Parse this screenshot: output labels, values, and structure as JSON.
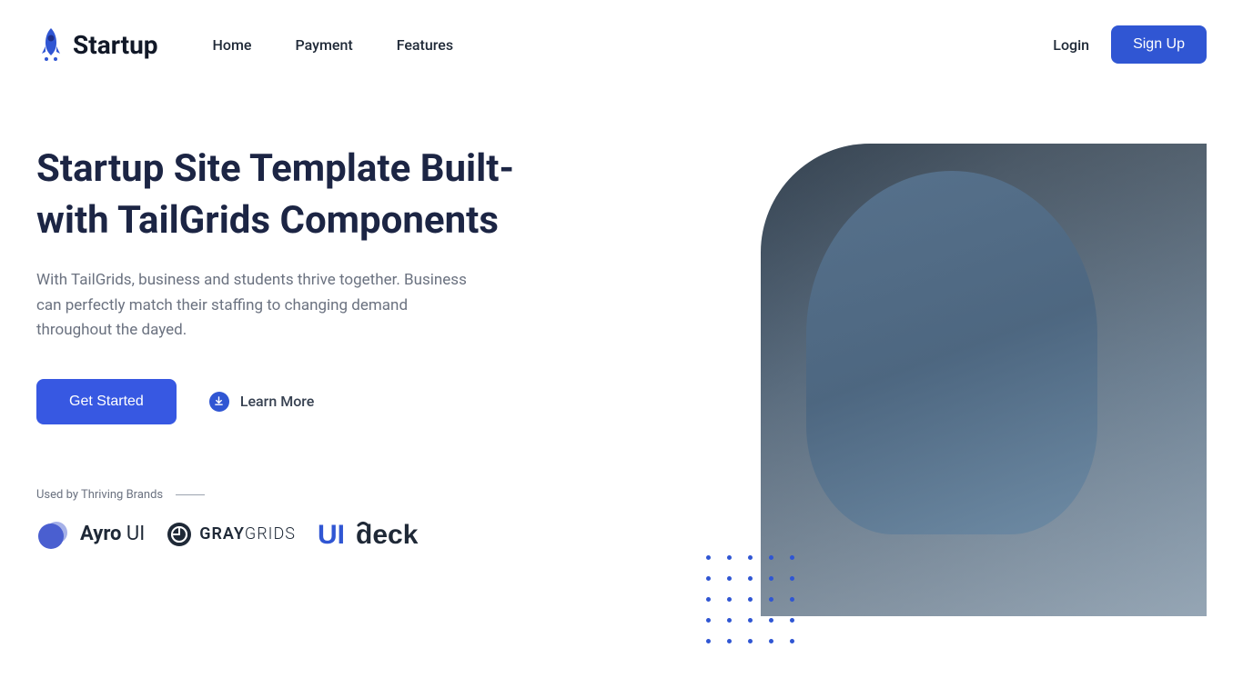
{
  "header": {
    "logo_text": "Startup",
    "nav": {
      "home": "Home",
      "payment": "Payment",
      "features": "Features"
    },
    "login": "Login",
    "signup": "Sign Up"
  },
  "hero": {
    "title": "Startup Site Template Built-with TailGrids Components",
    "description": "With TailGrids, business and students thrive together. Business can perfectly match their staffing to changing demand throughout the dayed.",
    "get_started": "Get Started",
    "learn_more": "Learn More"
  },
  "brands": {
    "label": "Used by Thriving Brands",
    "ayro_prefix": "Ayro",
    "ayro_suffix": " UI",
    "graygrids_prefix": "GRAY",
    "graygrids_suffix": "GRIDS",
    "uideck_prefix": "UI",
    "uideck_suffix": "deck"
  },
  "colors": {
    "primary": "#3056D3",
    "text_dark": "#1c2544",
    "text_muted": "#6b7280"
  }
}
